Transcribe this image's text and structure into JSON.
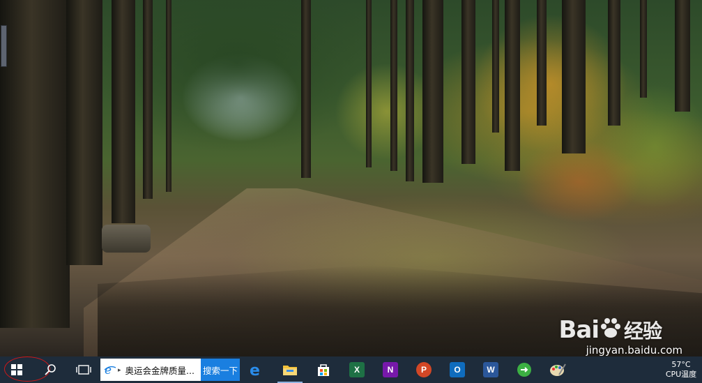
{
  "desktop": {
    "watermark_brand_left": "Bai",
    "watermark_brand_right": "经验",
    "watermark_site": "jingyan.baidu.com"
  },
  "taskbar": {
    "search_box": {
      "text": "奥运会金牌质量...",
      "button_label": "搜索一下"
    },
    "apps": [
      {
        "name": "edge",
        "icon": "edge-icon"
      },
      {
        "name": "file-explorer",
        "icon": "folder-icon",
        "active": true
      },
      {
        "name": "microsoft-store",
        "icon": "store-icon"
      },
      {
        "name": "excel",
        "icon": "excel-icon",
        "letter": "X",
        "color": "#1e7145"
      },
      {
        "name": "onenote",
        "icon": "onenote-icon",
        "letter": "N",
        "color": "#7719aa"
      },
      {
        "name": "powerpoint",
        "icon": "powerpoint-icon",
        "letter": "P",
        "color": "#d24726"
      },
      {
        "name": "outlook",
        "icon": "outlook-icon",
        "letter": "O",
        "color": "#0f6cbd"
      },
      {
        "name": "word",
        "icon": "word-icon",
        "letter": "W",
        "color": "#2b579a"
      },
      {
        "name": "green-app",
        "icon": "green-circle-icon",
        "color": "#3cb043"
      },
      {
        "name": "paint-app",
        "icon": "paint-icon"
      }
    ],
    "tray": {
      "temperature": "57°C",
      "label": "CPU温度"
    }
  },
  "colors": {
    "taskbar_bg": "#1e2c3b",
    "search_button": "#1a7fe0",
    "annotation_circle": "#d01818"
  }
}
